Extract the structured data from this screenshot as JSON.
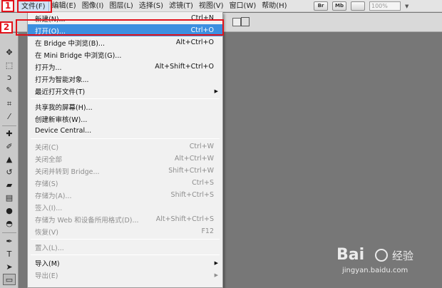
{
  "menubar": {
    "items": [
      "文件(F)",
      "编辑(E)",
      "图像(I)",
      "图层(L)",
      "选择(S)",
      "滤镜(T)",
      "视图(V)",
      "窗口(W)",
      "帮助(H)"
    ],
    "active_index": 0,
    "br_label": "Br",
    "mb_label": "Mb",
    "zoom": "100%"
  },
  "callouts": {
    "step1": "1",
    "step2": "2"
  },
  "file_menu": {
    "items": [
      {
        "label": "新建(N)...",
        "shortcut": "Ctrl+N"
      },
      {
        "label": "打开(O)...",
        "shortcut": "Ctrl+O",
        "highlighted": true
      },
      {
        "label": "在 Bridge 中浏览(B)...",
        "shortcut": "Alt+Ctrl+O"
      },
      {
        "label": "在 Mini Bridge 中浏览(G)...",
        "shortcut": ""
      },
      {
        "label": "打开为...",
        "shortcut": "Alt+Shift+Ctrl+O"
      },
      {
        "label": "打开为智能对象...",
        "shortcut": ""
      },
      {
        "label": "最近打开文件(T)",
        "shortcut": "",
        "submenu": true
      },
      {
        "label": "共享我的屏幕(H)...",
        "shortcut": ""
      },
      {
        "label": "创建新审核(W)...",
        "shortcut": ""
      },
      {
        "label": "Device Central...",
        "shortcut": ""
      },
      {
        "label": "关闭(C)",
        "shortcut": "Ctrl+W",
        "disabled": true
      },
      {
        "label": "关闭全部",
        "shortcut": "Alt+Ctrl+W",
        "disabled": true
      },
      {
        "label": "关闭并转到 Bridge...",
        "shortcut": "Shift+Ctrl+W",
        "disabled": true
      },
      {
        "label": "存储(S)",
        "shortcut": "Ctrl+S",
        "disabled": true
      },
      {
        "label": "存储为(A)...",
        "shortcut": "Shift+Ctrl+S",
        "disabled": true
      },
      {
        "label": "签入(I)...",
        "shortcut": "",
        "disabled": true
      },
      {
        "label": "存储为 Web 和设备所用格式(D)...",
        "shortcut": "Alt+Shift+Ctrl+S",
        "disabled": true
      },
      {
        "label": "恢复(V)",
        "shortcut": "F12",
        "disabled": true
      },
      {
        "label": "置入(L)...",
        "shortcut": "",
        "disabled": true
      },
      {
        "label": "导入(M)",
        "shortcut": "",
        "submenu": true
      },
      {
        "label": "导出(E)",
        "shortcut": "",
        "submenu": true,
        "disabled": true
      }
    ]
  },
  "tools": [
    "move-tool-icon",
    "marquee-tool-icon",
    "lasso-tool-icon",
    "quick-select-tool-icon",
    "crop-tool-icon",
    "eyedropper-tool-icon",
    "healing-brush-icon",
    "brush-tool-icon",
    "clone-stamp-icon",
    "history-brush-icon",
    "eraser-tool-icon",
    "gradient-tool-icon",
    "blur-tool-icon",
    "dodge-tool-icon",
    "pen-tool-icon",
    "type-tool-icon",
    "path-select-icon",
    "shape-tool-icon"
  ],
  "watermark": {
    "logo": "Bai",
    "logo_tail": "经验",
    "url": "jingyan.baidu.com"
  },
  "colors": {
    "highlight": "#3d8fe0",
    "callout": "#e2121b",
    "workspace": "#777777"
  }
}
